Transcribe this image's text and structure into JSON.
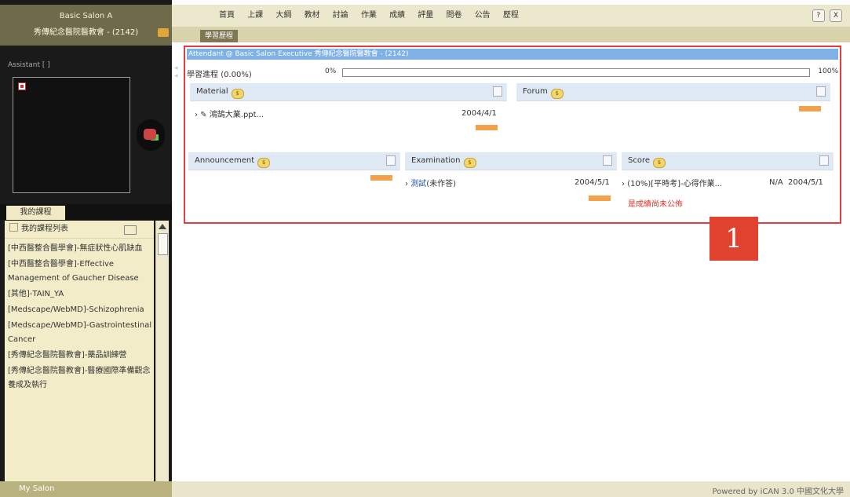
{
  "sidebar": {
    "title_line1": "Basic Salon A",
    "title_line2": "秀傳紀念醫院醫教會 - (2142)",
    "assistant_label": "Assistant [ ]",
    "tab_label": "我的課程",
    "course_list_header": "我的課程列表",
    "courses": [
      "[中西醫整合醫學會]-無症狀性心肌缺血",
      "[中西醫整合醫學會]-Effective Management of Gaucher Disease",
      "[其他]-TAIN_YA",
      "[Medscape/WebMD]-Schizophrenia",
      "[Medscape/WebMD]-Gastrointestinal Cancer",
      "[秀傳紀念醫院醫教會]-藥品訓練營",
      "[秀傳紀念醫院醫教會]-醫療國際準備觀念養成及執行"
    ],
    "footer": "My Salon"
  },
  "topnav": {
    "items": [
      "首頁",
      "上課",
      "大綱",
      "教材",
      "討論",
      "作業",
      "成績",
      "評量",
      "問卷",
      "公告",
      "歷程"
    ],
    "subtab": "學習歷程",
    "help_label": "?",
    "close_label": "X"
  },
  "main": {
    "title": "Attendant @ Basic Salon Executive 秀傳紀念醫院醫教會 - (2142)",
    "progress": {
      "label": "學習進程",
      "value_text": "(0.00%)",
      "min_label": "0%",
      "max_label": "100%",
      "fraction": 0.0
    },
    "material": {
      "title": "Material",
      "item_name": "鴻鵠大業.ppt...",
      "item_date": "2004/4/1"
    },
    "forum": {
      "title": "Forum"
    },
    "announcement": {
      "title": "Announcement"
    },
    "examination": {
      "title": "Examination",
      "item_prefix": "測試",
      "item_suffix": "(未作答)",
      "item_date": "2004/5/1"
    },
    "score": {
      "title": "Score",
      "item_name": "(10%)[平時考]-心得作業...",
      "item_value": "N/A",
      "item_date": "2004/5/1",
      "notice": "是成績尚未公佈"
    }
  },
  "badge": "1",
  "status": {
    "text": "Powered by iCAN 3.0 中國文化大學"
  },
  "colors": {
    "frame": "#e23e3e",
    "title_bar": "#7fb0e6",
    "more_button": "#f2a24a",
    "badge": "#e1412f"
  }
}
